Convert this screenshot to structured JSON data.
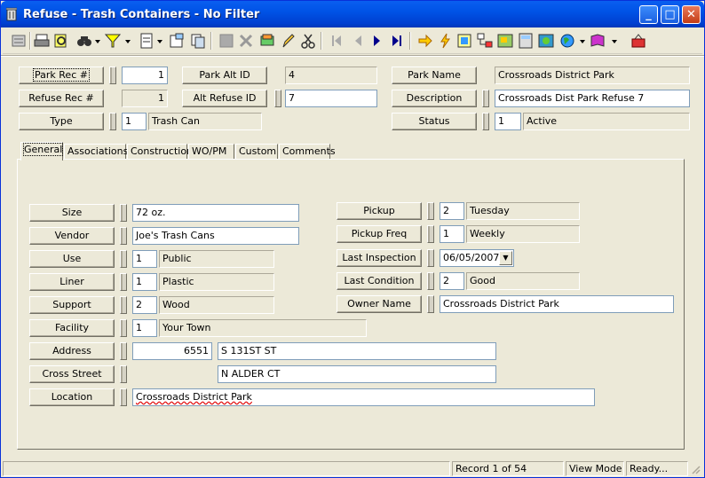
{
  "window": {
    "title": "Refuse - Trash Containers - No Filter"
  },
  "header": {
    "park_rec_label": "Park Rec #",
    "park_rec_value": "1",
    "park_alt_id_label": "Park Alt ID",
    "park_alt_id_value": "4",
    "park_name_label": "Park Name",
    "park_name_value": "Crossroads District Park",
    "refuse_rec_label": "Refuse Rec #",
    "refuse_rec_value": "1",
    "alt_refuse_id_label": "Alt Refuse ID",
    "alt_refuse_id_value": "7",
    "description_label": "Description",
    "description_value": "Crossroads Dist Park Refuse 7",
    "type_label": "Type",
    "type_code": "1",
    "type_value": "Trash Can",
    "status_label": "Status",
    "status_code": "1",
    "status_value": "Active"
  },
  "tabs": [
    {
      "label": "General"
    },
    {
      "label": "Associations"
    },
    {
      "label": "Construction"
    },
    {
      "label": "WO/PM"
    },
    {
      "label": "Custom"
    },
    {
      "label": "Comments"
    }
  ],
  "general": {
    "size_label": "Size",
    "size_value": "72 oz.",
    "vendor_label": "Vendor",
    "vendor_value": "Joe's Trash Cans",
    "use_label": "Use",
    "use_code": "1",
    "use_value": "Public",
    "liner_label": "Liner",
    "liner_code": "1",
    "liner_value": "Plastic",
    "support_label": "Support",
    "support_code": "2",
    "support_value": "Wood",
    "facility_label": "Facility",
    "facility_code": "1",
    "facility_value": "Your Town",
    "address_label": "Address",
    "address_number": "6551",
    "address_street": "S 131ST ST",
    "cross_street_label": "Cross Street",
    "cross_street_value": "N ALDER CT",
    "location_label": "Location",
    "location_value": "Crossroads District Park",
    "pickup_label": "Pickup",
    "pickup_code": "2",
    "pickup_value": "Tuesday",
    "pickup_freq_label": "Pickup Freq",
    "pickup_freq_code": "1",
    "pickup_freq_value": "Weekly",
    "last_inspection_label": "Last Inspection",
    "last_inspection_value": "06/05/2007",
    "last_condition_label": "Last Condition",
    "last_condition_code": "2",
    "last_condition_value": "Good",
    "owner_name_label": "Owner Name",
    "owner_name_value": "Crossroads District Park"
  },
  "status": {
    "record": "Record 1 of 54",
    "mode": "View Mode",
    "state": "Ready..."
  },
  "toolbar_icons": [
    "new-record-icon",
    "print-icon",
    "print-preview-icon",
    "find-icon",
    "filter-icon",
    "report-icon",
    "properties-icon",
    "copy-icon",
    "save-icon",
    "delete-icon",
    "attach-icon",
    "edit-icon",
    "cut-icon",
    "first-record-icon",
    "previous-record-icon",
    "next-record-icon",
    "last-record-icon",
    "go-icon",
    "lightning-icon",
    "workorder-icon",
    "hierarchy-icon",
    "map-icon",
    "calculator-icon",
    "gis-icon",
    "globe-icon",
    "book-icon",
    "exit-icon"
  ],
  "colors": {
    "title_bar": "#0053e6",
    "window_bg": "#ece9d8",
    "field_bg": "#ffffff"
  }
}
